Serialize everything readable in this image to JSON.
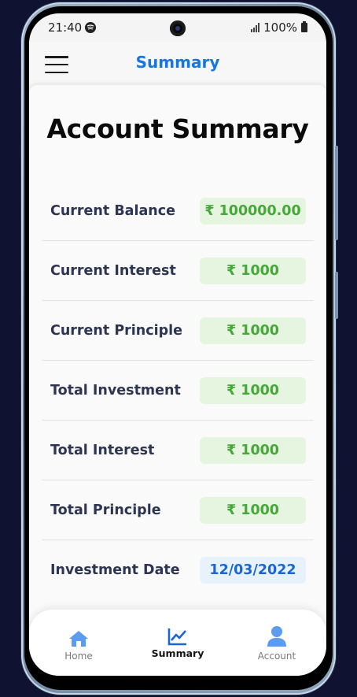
{
  "status_bar": {
    "time": "21:40",
    "battery": "100%",
    "icons": [
      "spotify-icon",
      "signal-icon",
      "battery-icon"
    ]
  },
  "header": {
    "title": "Summary",
    "menu_icon": "hamburger-menu-icon"
  },
  "main": {
    "title": "Account Summary",
    "rows": [
      {
        "label": "Current Balance",
        "value": "₹ 100000.00",
        "kind": "money"
      },
      {
        "label": "Current Interest",
        "value": "₹ 1000",
        "kind": "money"
      },
      {
        "label": "Current Principle",
        "value": "₹ 1000",
        "kind": "money"
      },
      {
        "label": "Total Investment",
        "value": "₹ 1000",
        "kind": "money"
      },
      {
        "label": "Total Interest",
        "value": "₹ 1000",
        "kind": "money"
      },
      {
        "label": "Total Principle",
        "value": "₹ 1000",
        "kind": "money"
      },
      {
        "label": "Investment Date",
        "value": "12/03/2022",
        "kind": "date"
      }
    ]
  },
  "bottom_nav": {
    "items": [
      {
        "label": "Home",
        "icon": "home-icon",
        "active": false
      },
      {
        "label": "Summary",
        "icon": "chart-line-icon",
        "active": true
      },
      {
        "label": "Account",
        "icon": "user-icon",
        "active": false
      }
    ]
  },
  "colors": {
    "accent": "#1976e0",
    "money_text": "#47a83a",
    "money_bg": "#e5f5df",
    "date_text": "#1a66d2",
    "date_bg": "#e7f2fd",
    "label_text": "#2d3552",
    "nav_icon": "#5b9bf0"
  }
}
